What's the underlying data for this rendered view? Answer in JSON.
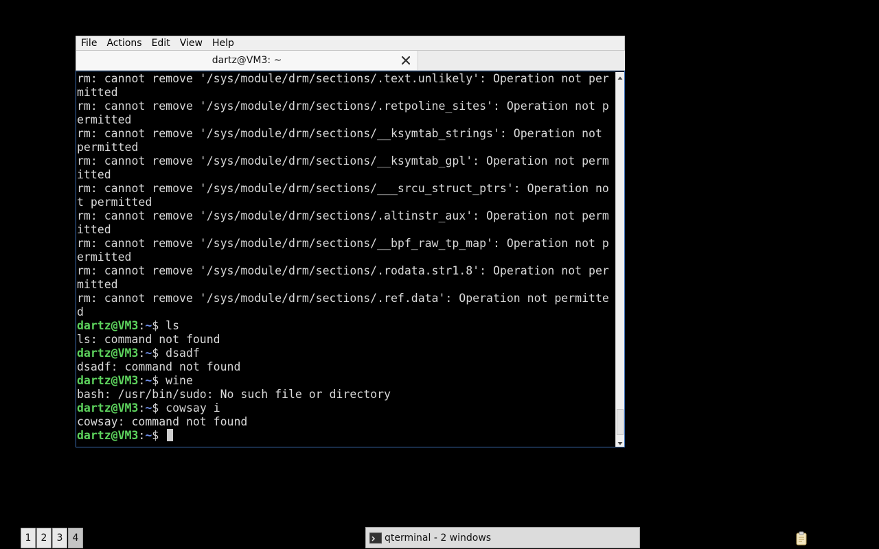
{
  "menu": [
    "File",
    "Actions",
    "Edit",
    "View",
    "Help"
  ],
  "tab": {
    "title": "dartz@VM3: ~"
  },
  "terminal": {
    "lines": [
      {
        "t": "rm: cannot remove '/sys/module/drm/sections/.text.unlikely': Operation not per"
      },
      {
        "t": "mitted"
      },
      {
        "t": "rm: cannot remove '/sys/module/drm/sections/.retpoline_sites': Operation not p"
      },
      {
        "t": "ermitted"
      },
      {
        "t": "rm: cannot remove '/sys/module/drm/sections/__ksymtab_strings': Operation not"
      },
      {
        "t": "permitted"
      },
      {
        "t": "rm: cannot remove '/sys/module/drm/sections/__ksymtab_gpl': Operation not perm"
      },
      {
        "t": "itted"
      },
      {
        "t": "rm: cannot remove '/sys/module/drm/sections/___srcu_struct_ptrs': Operation no"
      },
      {
        "t": "t permitted"
      },
      {
        "t": "rm: cannot remove '/sys/module/drm/sections/.altinstr_aux': Operation not perm"
      },
      {
        "t": "itted"
      },
      {
        "t": "rm: cannot remove '/sys/module/drm/sections/__bpf_raw_tp_map': Operation not p"
      },
      {
        "t": "ermitted"
      },
      {
        "t": "rm: cannot remove '/sys/module/drm/sections/.rodata.str1.8': Operation not per"
      },
      {
        "t": "mitted"
      },
      {
        "t": "rm: cannot remove '/sys/module/drm/sections/.ref.data': Operation not permitte"
      },
      {
        "t": "d"
      },
      {
        "u": "dartz@VM3",
        "d": "~",
        "c": " ls"
      },
      {
        "t": "ls: command not found"
      },
      {
        "u": "dartz@VM3",
        "d": "~",
        "c": " dsadf"
      },
      {
        "t": "dsadf: command not found"
      },
      {
        "u": "dartz@VM3",
        "d": "~",
        "c": " wine"
      },
      {
        "t": "bash: /usr/bin/sudo: No such file or directory"
      },
      {
        "u": "dartz@VM3",
        "d": "~",
        "c": " cowsay i"
      },
      {
        "t": "cowsay: command not found"
      },
      {
        "u": "dartz@VM3",
        "d": "~",
        "c": " ",
        "cursor": true
      }
    ],
    "colors": {
      "user": "#5dd25d",
      "dir": "#6f8fe8",
      "text": "#d8d8d8"
    }
  },
  "taskbar": {
    "workspaces": [
      "1",
      "2",
      "3",
      "4"
    ],
    "active_workspace": "4",
    "task_label": "qterminal - 2 windows",
    "tray_icon": "clipboard-icon"
  }
}
